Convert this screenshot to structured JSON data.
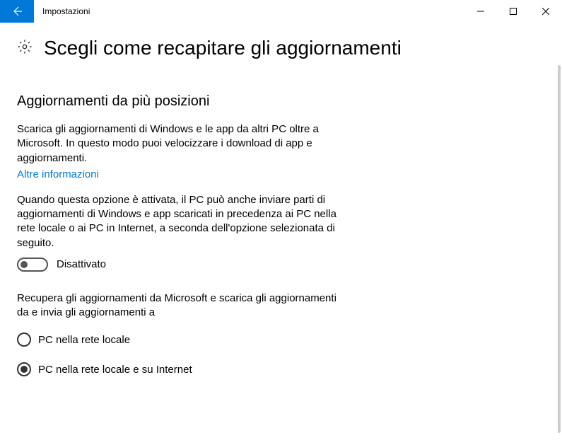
{
  "window": {
    "title": "Impostazioni"
  },
  "page": {
    "heading": "Scegli come recapitare gli aggiornamenti"
  },
  "section": {
    "title": "Aggiornamenti da più posizioni",
    "body1": "Scarica gli aggiornamenti di Windows e le app da altri PC oltre a Microsoft. In questo modo puoi velocizzare i download di app e aggiornamenti.",
    "learn_more": "Altre informazioni",
    "body2": "Quando questa opzione è attivata, il PC può anche inviare parti di aggiornamenti di Windows e app scaricati in precedenza ai PC nella rete locale o ai PC in Internet, a seconda dell'opzione selezionata di seguito.",
    "toggle_label": "Disattivato",
    "body3": "Recupera gli aggiornamenti da Microsoft e scarica gli aggiornamenti da e invia gli aggiornamenti a",
    "radio1": "PC nella rete locale",
    "radio2": "PC nella rete locale e su Internet"
  }
}
